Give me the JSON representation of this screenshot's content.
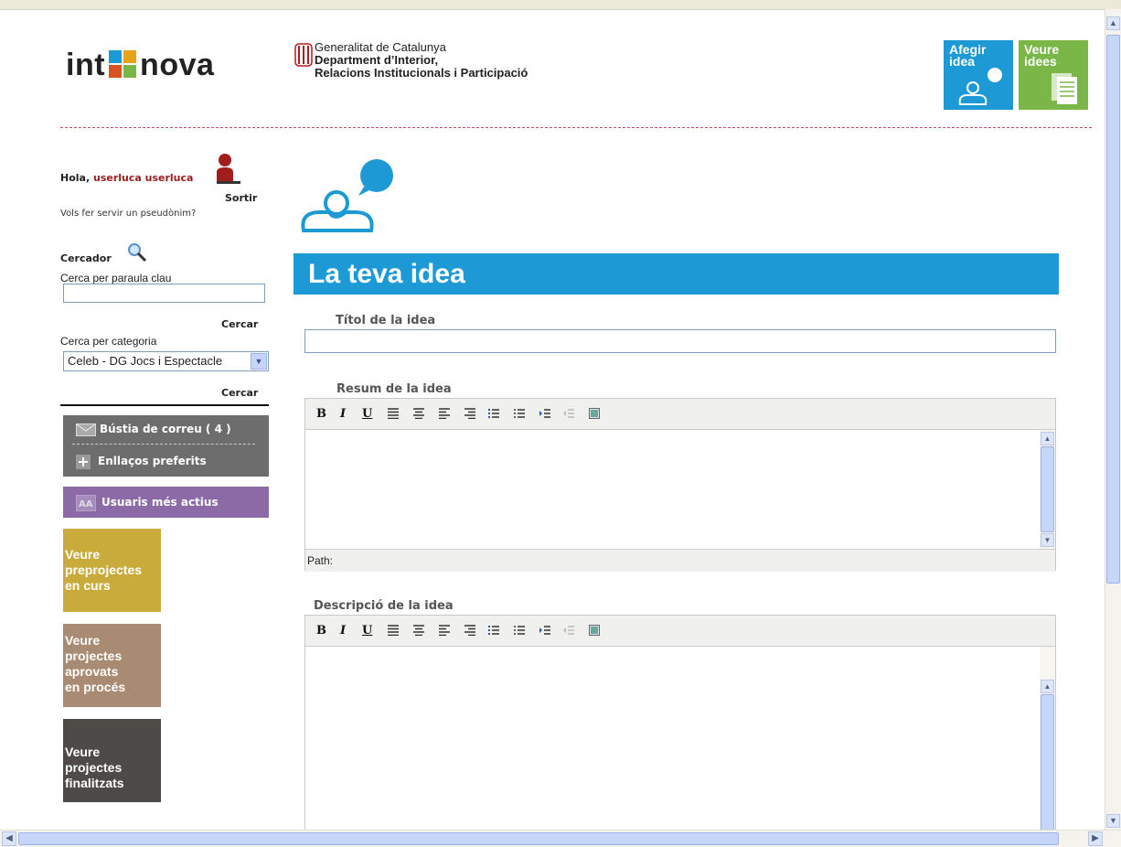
{
  "header": {
    "logo": {
      "left": "int",
      "right": "nova"
    },
    "gencat": {
      "line1": "Generalitat de Catalunya",
      "line2": "Department d’Interior,",
      "line3": "Relacions Institucionals i Participació"
    },
    "tiles": {
      "add_idea": {
        "line1": "Afegir",
        "line2": "idea"
      },
      "view_ideas": {
        "line1": "Veure",
        "line2": "idees"
      }
    }
  },
  "sidebar": {
    "greeting": "Hola,",
    "username": "userluca userluca",
    "logout": "Sortir",
    "pseudonym_question": "Vols fer servir un pseudònim?",
    "search_title": "Cercador",
    "keyword_label": "Cerca per paraula clau",
    "keyword_value": "",
    "search_button": "Cercar",
    "category_label": "Cerca per categoria",
    "category_selected": "Celeb - DG Jocs i Espectacle",
    "search_button_2": "Cercar",
    "mailbox": "Bústia de correu ( 4 )",
    "favorites": "Enllaços preferits",
    "active_users": "Usuaris més actius",
    "block1": [
      "Veure",
      "preprojectes",
      "en curs"
    ],
    "block2": [
      "Veure",
      "projectes",
      "aprovats",
      "en procés"
    ],
    "block3": [
      "Veure",
      "projectes",
      "finalitzats"
    ]
  },
  "main": {
    "banner_title": "La teva idea",
    "title_label": "Títol de la idea",
    "title_value": "",
    "summary_label": "Resum de la idea",
    "description_label": "Descripció de la idea",
    "path_label": "Path:",
    "toolbar": {
      "bold": "B",
      "italic": "I",
      "underline": "U"
    }
  },
  "colors": {
    "blue": "#1d9ad6",
    "green": "#7ab648",
    "dark_red": "#9b1c1c",
    "purple": "#8b6aa5",
    "mustard": "#c9ab3c",
    "brown": "#a88b72",
    "dark_gray": "#4d4a48"
  }
}
